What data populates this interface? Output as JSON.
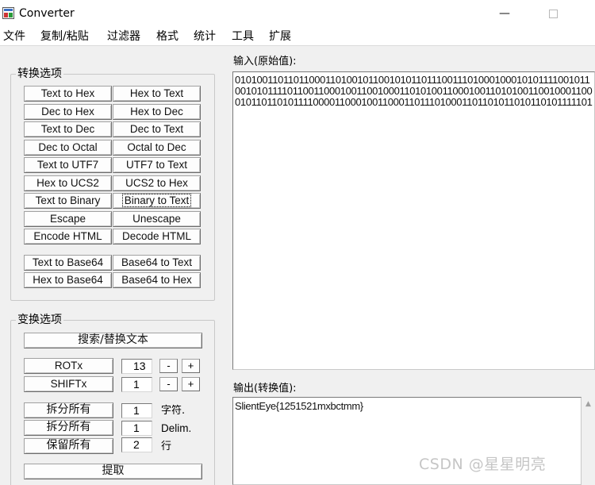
{
  "window": {
    "title": "Converter",
    "minimize_label": "—"
  },
  "menu": [
    "文件",
    "复制/粘贴",
    "过滤器",
    "格式",
    "统计",
    "工具",
    "扩展"
  ],
  "conversion_group": {
    "title": "转换选项",
    "buttons": [
      "Text to Hex",
      "Hex to Text",
      "Dec to Hex",
      "Hex to Dec",
      "Text to Dec",
      "Dec to Text",
      "Dec to Octal",
      "Octal to Dec",
      "Text to UTF7",
      "UTF7 to Text",
      "Hex to UCS2",
      "UCS2 to Hex",
      "Text to Binary",
      "Binary to Text",
      "Escape",
      "Unescape",
      "Encode HTML",
      "Decode HTML",
      "Text to Base64",
      "Base64 to Text",
      "Hex to Base64",
      "Base64 to Hex"
    ]
  },
  "transform_group": {
    "title": "变换选项",
    "search_replace_label": "搜索/替换文本",
    "rotx_label": "ROTx",
    "rotx_value": "13",
    "shiftx_label": "SHIFTx",
    "shiftx_value": "1",
    "minus_label": "-",
    "plus_label": "+",
    "split_all_chars_label": "拆分所有",
    "split_chars_value": "1",
    "chars_unit": "字符.",
    "split_all_delim_label": "拆分所有",
    "split_delim_value": "1",
    "delim_unit": "Delim.",
    "keep_all_label": "保留所有",
    "keep_value": "2",
    "lines_unit": "行",
    "extract_label": "提取"
  },
  "input": {
    "label": "输入(原始值):",
    "value": "0101001101101100011010010110010101101110011101000100010101111001011001010111101100110001001100100011010100110001001101010011001000110001011011010111100001100010011000110111010001101101011010110101111101"
  },
  "output": {
    "label": "输出(转换值):",
    "value": "SlientEye{1251521mxbctmm}"
  },
  "watermark": "CSDN @星星明亮"
}
